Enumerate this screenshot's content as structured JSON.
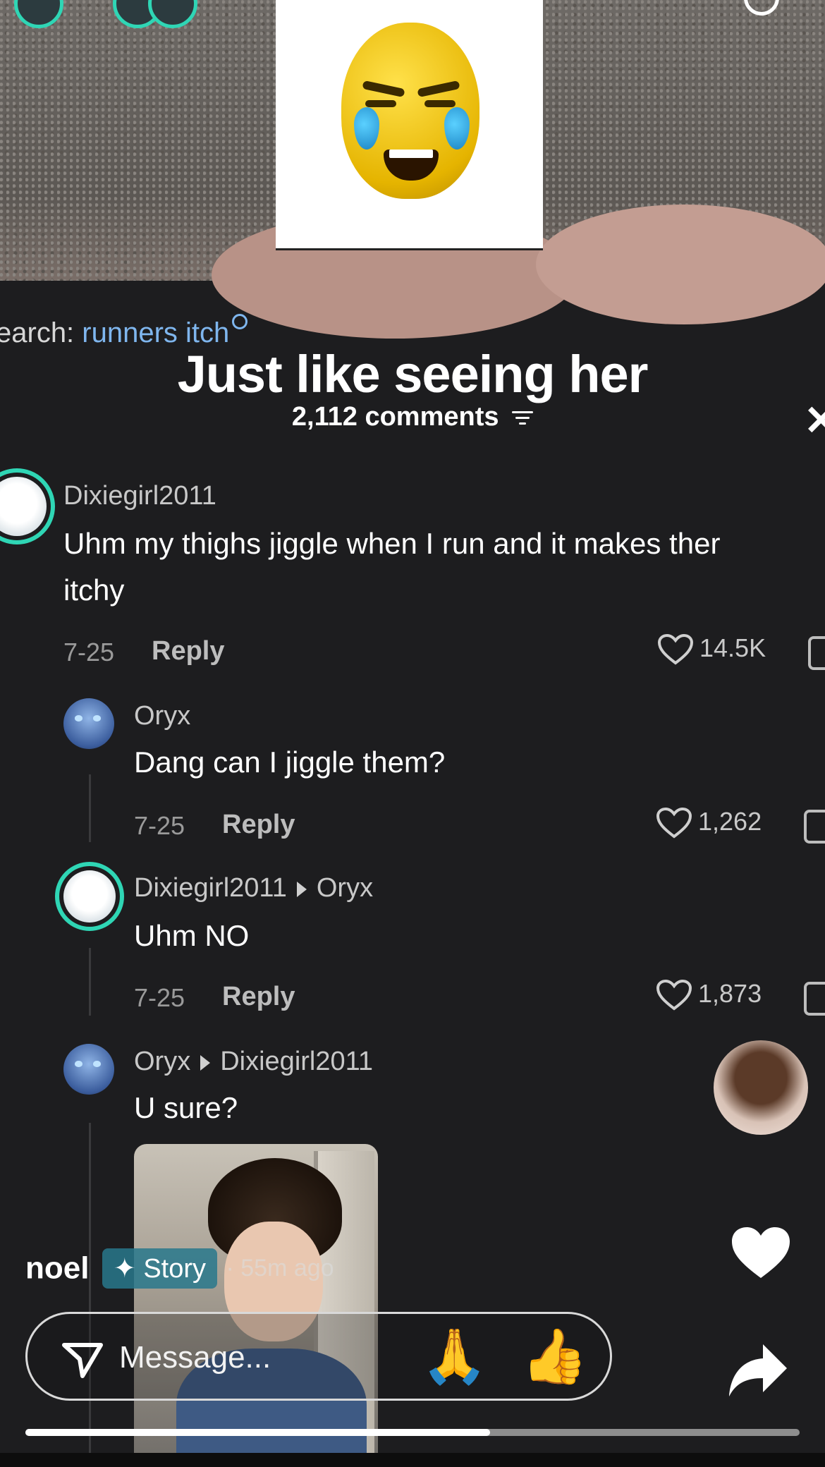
{
  "search": {
    "prefix": "earch:",
    "query": "runners itch"
  },
  "video": {
    "caption": "Just like seeing her"
  },
  "comments_header": {
    "count_label": "2,112 comments"
  },
  "comments": [
    {
      "user": "Dixiegirl2011",
      "reply_to": "",
      "lines": [
        "Uhm my thighs jiggle when I run and it makes ther",
        "itchy"
      ],
      "date": "7-25",
      "reply_label": "Reply",
      "likes": "14.5K"
    },
    {
      "user": "Oryx",
      "reply_to": "",
      "lines": [
        "Dang can I jiggle them?"
      ],
      "date": "7-25",
      "reply_label": "Reply",
      "likes": "1,262"
    },
    {
      "user": "Dixiegirl2011",
      "reply_to": "Oryx",
      "lines": [
        "Uhm NO"
      ],
      "date": "7-25",
      "reply_label": "Reply",
      "likes": "1,873"
    },
    {
      "user": "Oryx",
      "reply_to": "Dixiegirl2011",
      "lines": [
        "U sure?"
      ]
    }
  ],
  "story": {
    "username": "noel",
    "badge": "Story",
    "time": "· 55m ago"
  },
  "message_bar": {
    "placeholder": "Message...",
    "quick_emojis": [
      "🙏",
      "👍"
    ]
  },
  "progress": {
    "fraction": 0.6
  },
  "colors": {
    "accent_ring": "#2fd6b5",
    "link": "#7fb6ee",
    "background": "#1d1d1f"
  },
  "icons": [
    "search-icon",
    "close-icon",
    "filter-icon",
    "heart-outline-icon",
    "dislike-icon",
    "send-icon",
    "heart-icon",
    "share-icon",
    "sparkle-icon"
  ]
}
